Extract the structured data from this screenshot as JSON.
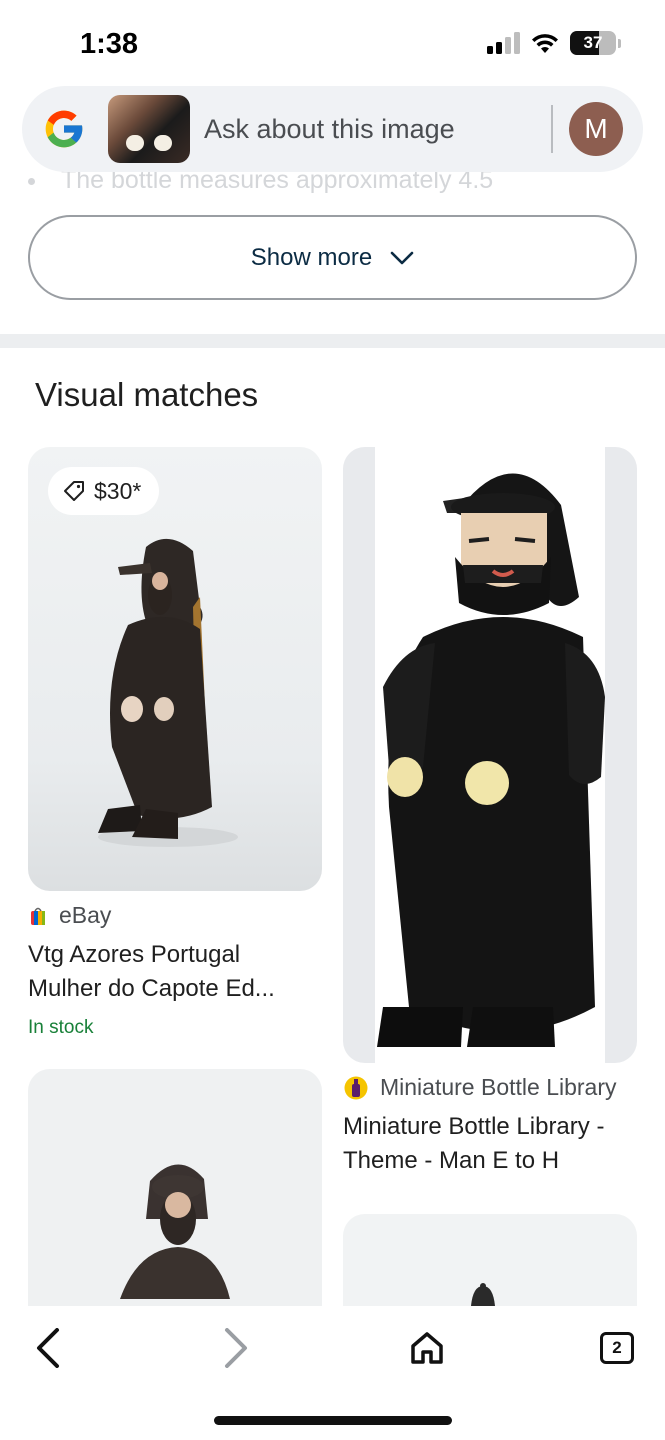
{
  "status_bar": {
    "time": "1:38",
    "battery": "37"
  },
  "search": {
    "placeholder": "Ask about this image",
    "avatar_letter": "M"
  },
  "faded_line": "The bottle measures approximately 4.5",
  "show_more_label": "Show more",
  "section_title": "Visual matches",
  "cards": [
    {
      "price": "$30*",
      "source": "eBay",
      "title_line1": "Vtg Azores Portugal",
      "title_line2": "Mulher do Capote Ed...",
      "status": "In stock"
    },
    {
      "source": "Miniature Bottle Library",
      "title_line1": "Miniature Bottle Library -",
      "title_line2": "Theme - Man E to H"
    }
  ],
  "nav": {
    "tab_count": "2"
  },
  "colors": {
    "accent_green": "#188038",
    "avatar": "#8d5e50",
    "link_dark": "#0b2b43"
  }
}
